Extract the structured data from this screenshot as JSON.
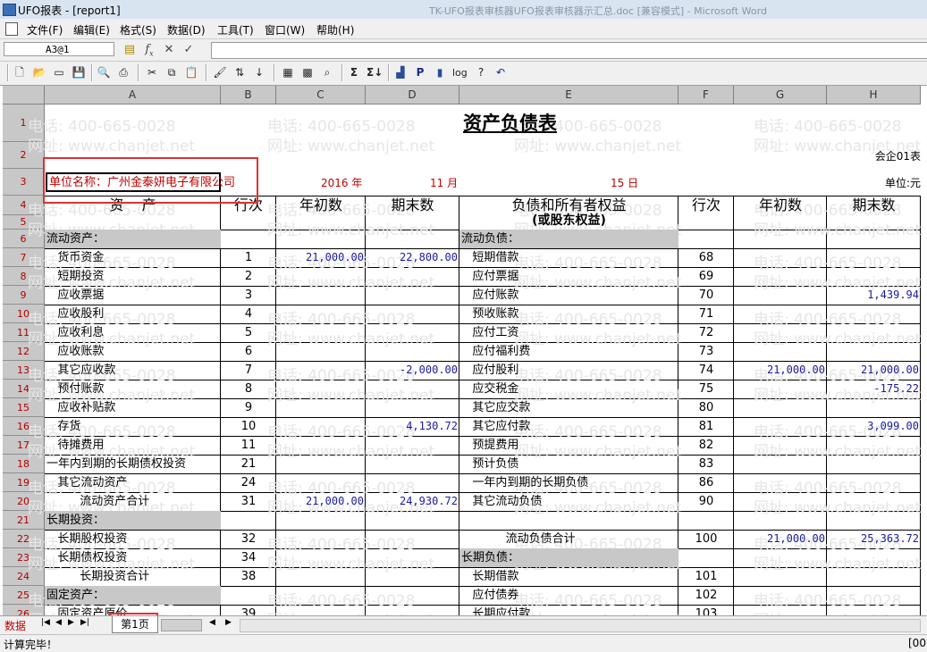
{
  "window": {
    "title": "UFO报表 - [report1]",
    "background_title": "TK-UFO报表审核器UFO报表审核器示汇总.doc [兼容模式] - Microsoft Word"
  },
  "menu": [
    "文件(F)",
    "编辑(E)",
    "格式(S)",
    "数据(D)",
    "工具(T)",
    "窗口(W)",
    "帮助(H)"
  ],
  "editbar": {
    "cell_ref": "A3@1",
    "formula": ""
  },
  "columns": [
    "A",
    "B",
    "C",
    "D",
    "E",
    "F",
    "G",
    "H"
  ],
  "rows": [
    "1",
    "2",
    "3",
    "4",
    "5",
    "6",
    "7",
    "8",
    "9",
    "10",
    "11",
    "12",
    "13",
    "14",
    "15",
    "16",
    "17",
    "18",
    "19",
    "20",
    "21",
    "22",
    "23",
    "24",
    "25",
    "26"
  ],
  "watermark": {
    "phone": "电话: 400-665-0028",
    "site": "网址: www.chanjet.net"
  },
  "report": {
    "title": "资产负债表",
    "form_code": "会企01表",
    "company": "单位名称：广州金泰妍电子有限公司",
    "year": "2016 年",
    "month": "11 月",
    "day": "15 日",
    "unit": "单位:元",
    "headers": {
      "asset": "资    产",
      "line": "行次",
      "begin": "年初数",
      "end": "期末数",
      "liab1": "负债和所有者权益",
      "liab2": "(或股东权益)",
      "line2": "行次",
      "begin2": "年初数",
      "end2": "期末数"
    },
    "left": [
      {
        "r": 6,
        "name": "流动资产：",
        "hl": true
      },
      {
        "r": 7,
        "name": "   货币资金",
        "line": "1",
        "begin": "21,000.00",
        "end": "22,800.00"
      },
      {
        "r": 8,
        "name": "   短期投资",
        "line": "2"
      },
      {
        "r": 9,
        "name": "   应收票据",
        "line": "3"
      },
      {
        "r": 10,
        "name": "   应收股利",
        "line": "4"
      },
      {
        "r": 11,
        "name": "   应收利息",
        "line": "5"
      },
      {
        "r": 12,
        "name": "   应收账款",
        "line": "6"
      },
      {
        "r": 13,
        "name": "   其它应收款",
        "line": "7",
        "end": "-2,000.00"
      },
      {
        "r": 14,
        "name": "   预付账款",
        "line": "8"
      },
      {
        "r": 15,
        "name": "   应收补贴款",
        "line": "9"
      },
      {
        "r": 16,
        "name": "   存货",
        "line": "10",
        "end": "4,130.72"
      },
      {
        "r": 17,
        "name": "   待摊费用",
        "line": "11"
      },
      {
        "r": 18,
        "name": "一年内到期的长期债权投资",
        "line": "21"
      },
      {
        "r": 19,
        "name": "   其它流动资产",
        "line": "24"
      },
      {
        "r": 20,
        "name": "         流动资产合计",
        "line": "31",
        "begin": "21,000.00",
        "end": "24,930.72"
      },
      {
        "r": 21,
        "name": "长期投资：",
        "hl": true
      },
      {
        "r": 22,
        "name": "   长期股权投资",
        "line": "32"
      },
      {
        "r": 23,
        "name": "   长期债权投资",
        "line": "34"
      },
      {
        "r": 24,
        "name": "         长期投资合计",
        "line": "38"
      },
      {
        "r": 25,
        "name": "固定资产：",
        "hl": true
      },
      {
        "r": 26,
        "name": "   固定资产原价",
        "line": "39"
      }
    ],
    "right": [
      {
        "r": 6,
        "name": "流动负债：",
        "hl": true
      },
      {
        "r": 7,
        "name": "   短期借款",
        "line": "68"
      },
      {
        "r": 8,
        "name": "   应付票据",
        "line": "69"
      },
      {
        "r": 9,
        "name": "   应付账款",
        "line": "70",
        "end": "1,439.94"
      },
      {
        "r": 10,
        "name": "   预收账款",
        "line": "71"
      },
      {
        "r": 11,
        "name": "   应付工资",
        "line": "72"
      },
      {
        "r": 12,
        "name": "   应付福利费",
        "line": "73"
      },
      {
        "r": 13,
        "name": "   应付股利",
        "line": "74",
        "begin": "21,000.00",
        "end": "21,000.00"
      },
      {
        "r": 14,
        "name": "   应交税金",
        "line": "75",
        "end": "-175.22"
      },
      {
        "r": 15,
        "name": "   其它应交款",
        "line": "80"
      },
      {
        "r": 16,
        "name": "   其它应付款",
        "line": "81",
        "end": "3,099.00"
      },
      {
        "r": 17,
        "name": "   预提费用",
        "line": "82"
      },
      {
        "r": 18,
        "name": "   预计负债",
        "line": "83"
      },
      {
        "r": 19,
        "name": "   一年内到期的长期负债",
        "line": "86"
      },
      {
        "r": 20,
        "name": "   其它流动负债",
        "line": "90"
      },
      {
        "r": 22,
        "name": "            流动负债合计",
        "line": "100",
        "begin": "21,000.00",
        "end": "25,363.72"
      },
      {
        "r": 23,
        "name": "长期负债：",
        "hl": true
      },
      {
        "r": 24,
        "name": "   长期借款",
        "line": "101"
      },
      {
        "r": 25,
        "name": "   应付债券",
        "line": "102"
      },
      {
        "r": 26,
        "name": "   长期应付款",
        "line": "103"
      }
    ]
  },
  "sheetbar": {
    "mode": "数据",
    "tab": "第1页"
  },
  "status": {
    "text": "计算完毕！",
    "right": "[00"
  },
  "colors": {
    "annotation": "#e03030",
    "number": "#1a1a9c",
    "company": "#c00000"
  }
}
